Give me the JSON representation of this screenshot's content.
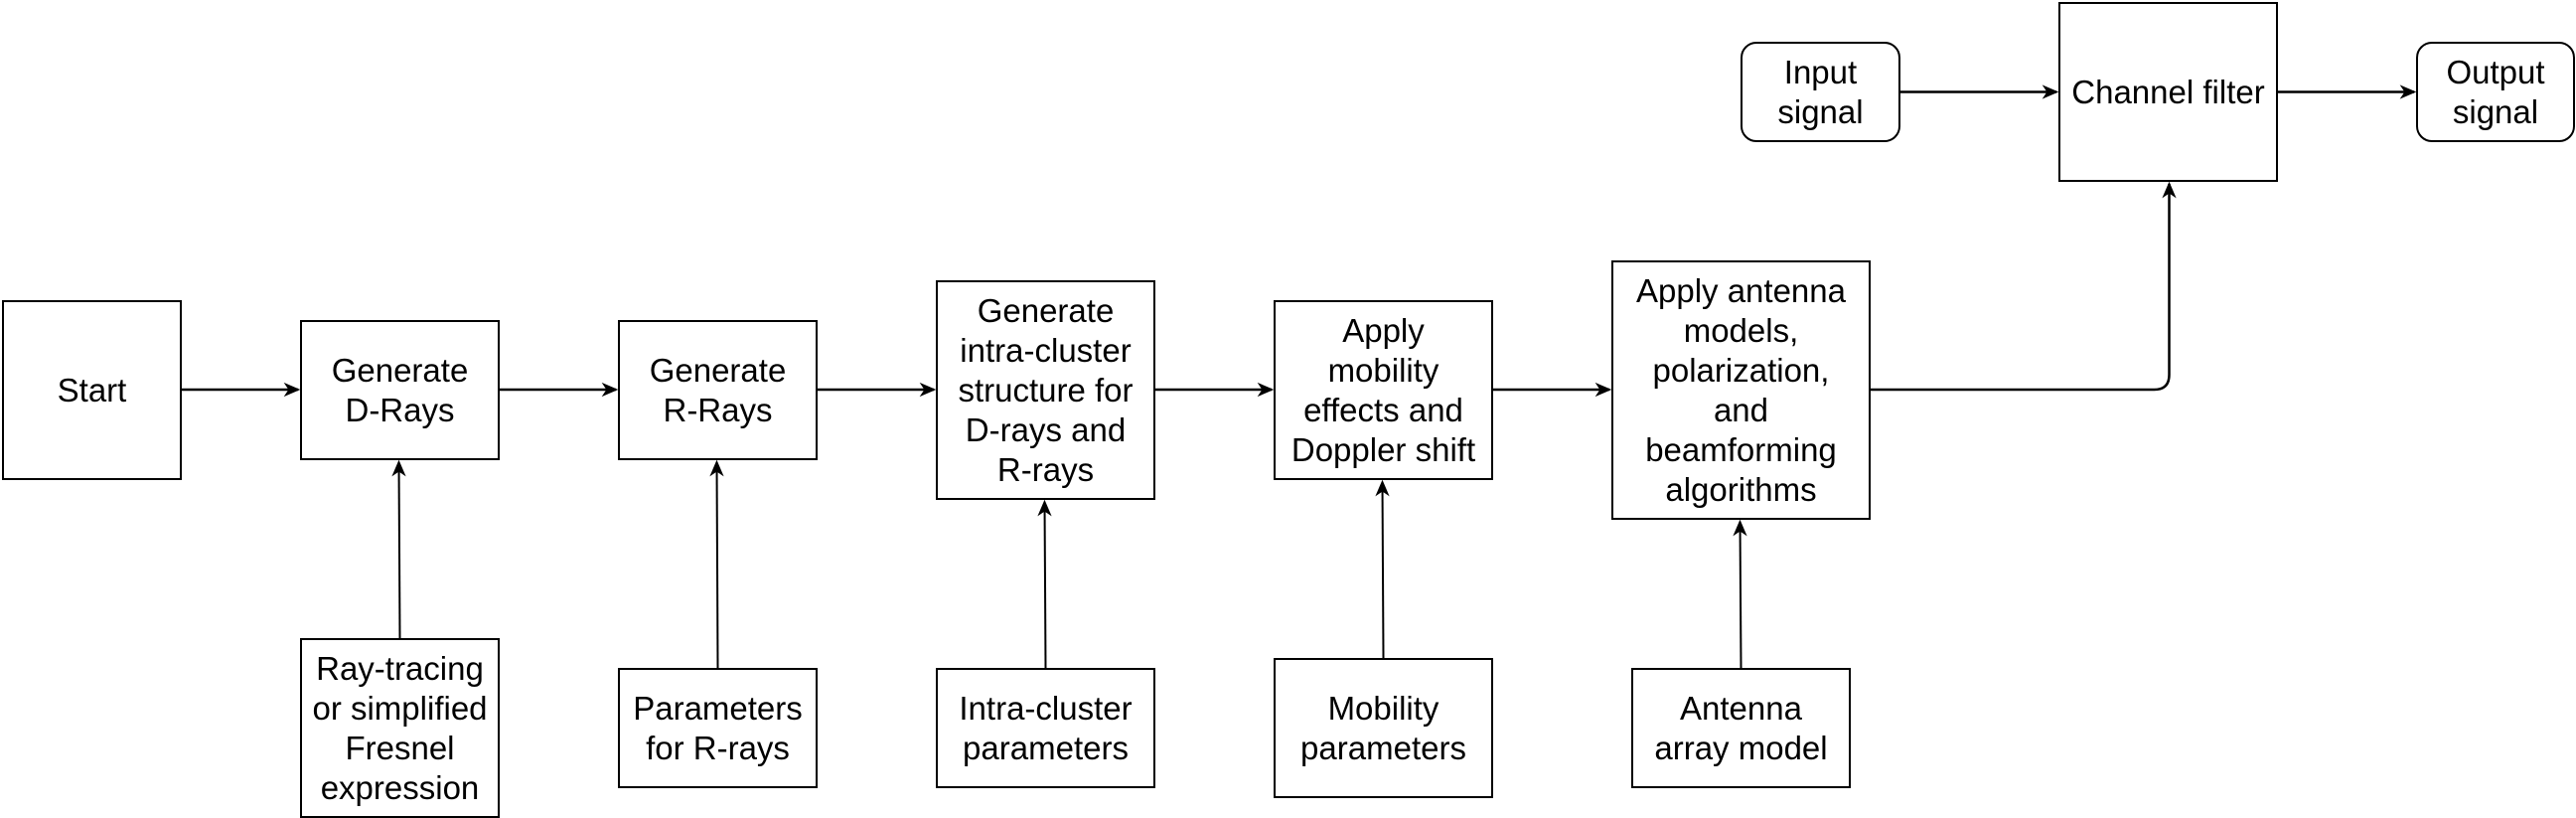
{
  "diagram": {
    "type": "flowchart",
    "nodes": {
      "start": "Start",
      "generate_d_rays": "Generate\nD-Rays",
      "generate_r_rays": "Generate\nR-Rays",
      "generate_intra_cluster": "Generate\nintra-cluster\nstructure for\nD-rays and\nR-rays",
      "apply_mobility": "Apply\nmobility\neffects and\nDoppler shift",
      "apply_antenna": "Apply antenna\nmodels,\npolarization,\nand\nbeamforming\nalgorithms",
      "input_signal": "Input\nsignal",
      "channel_filter": "Channel filter",
      "output_signal": "Output\nsignal",
      "ray_tracing": "Ray-tracing\nor simplified\nFresnel\nexpression",
      "params_r_rays": "Parameters\nfor R-rays",
      "intra_cluster_params": "Intra-cluster\nparameters",
      "mobility_params": "Mobility\nparameters",
      "antenna_array_model": "Antenna\narray model"
    },
    "edges": [
      {
        "from": "start",
        "to": "generate_d_rays"
      },
      {
        "from": "generate_d_rays",
        "to": "generate_r_rays"
      },
      {
        "from": "generate_r_rays",
        "to": "generate_intra_cluster"
      },
      {
        "from": "generate_intra_cluster",
        "to": "apply_mobility"
      },
      {
        "from": "apply_mobility",
        "to": "apply_antenna"
      },
      {
        "from": "apply_antenna",
        "to": "channel_filter"
      },
      {
        "from": "input_signal",
        "to": "channel_filter"
      },
      {
        "from": "channel_filter",
        "to": "output_signal"
      },
      {
        "from": "ray_tracing",
        "to": "generate_d_rays"
      },
      {
        "from": "params_r_rays",
        "to": "generate_r_rays"
      },
      {
        "from": "intra_cluster_params",
        "to": "generate_intra_cluster"
      },
      {
        "from": "mobility_params",
        "to": "apply_mobility"
      },
      {
        "from": "antenna_array_model",
        "to": "apply_antenna"
      }
    ],
    "colors": {
      "stroke": "#000000",
      "fill": "#ffffff",
      "text": "#000000"
    }
  }
}
